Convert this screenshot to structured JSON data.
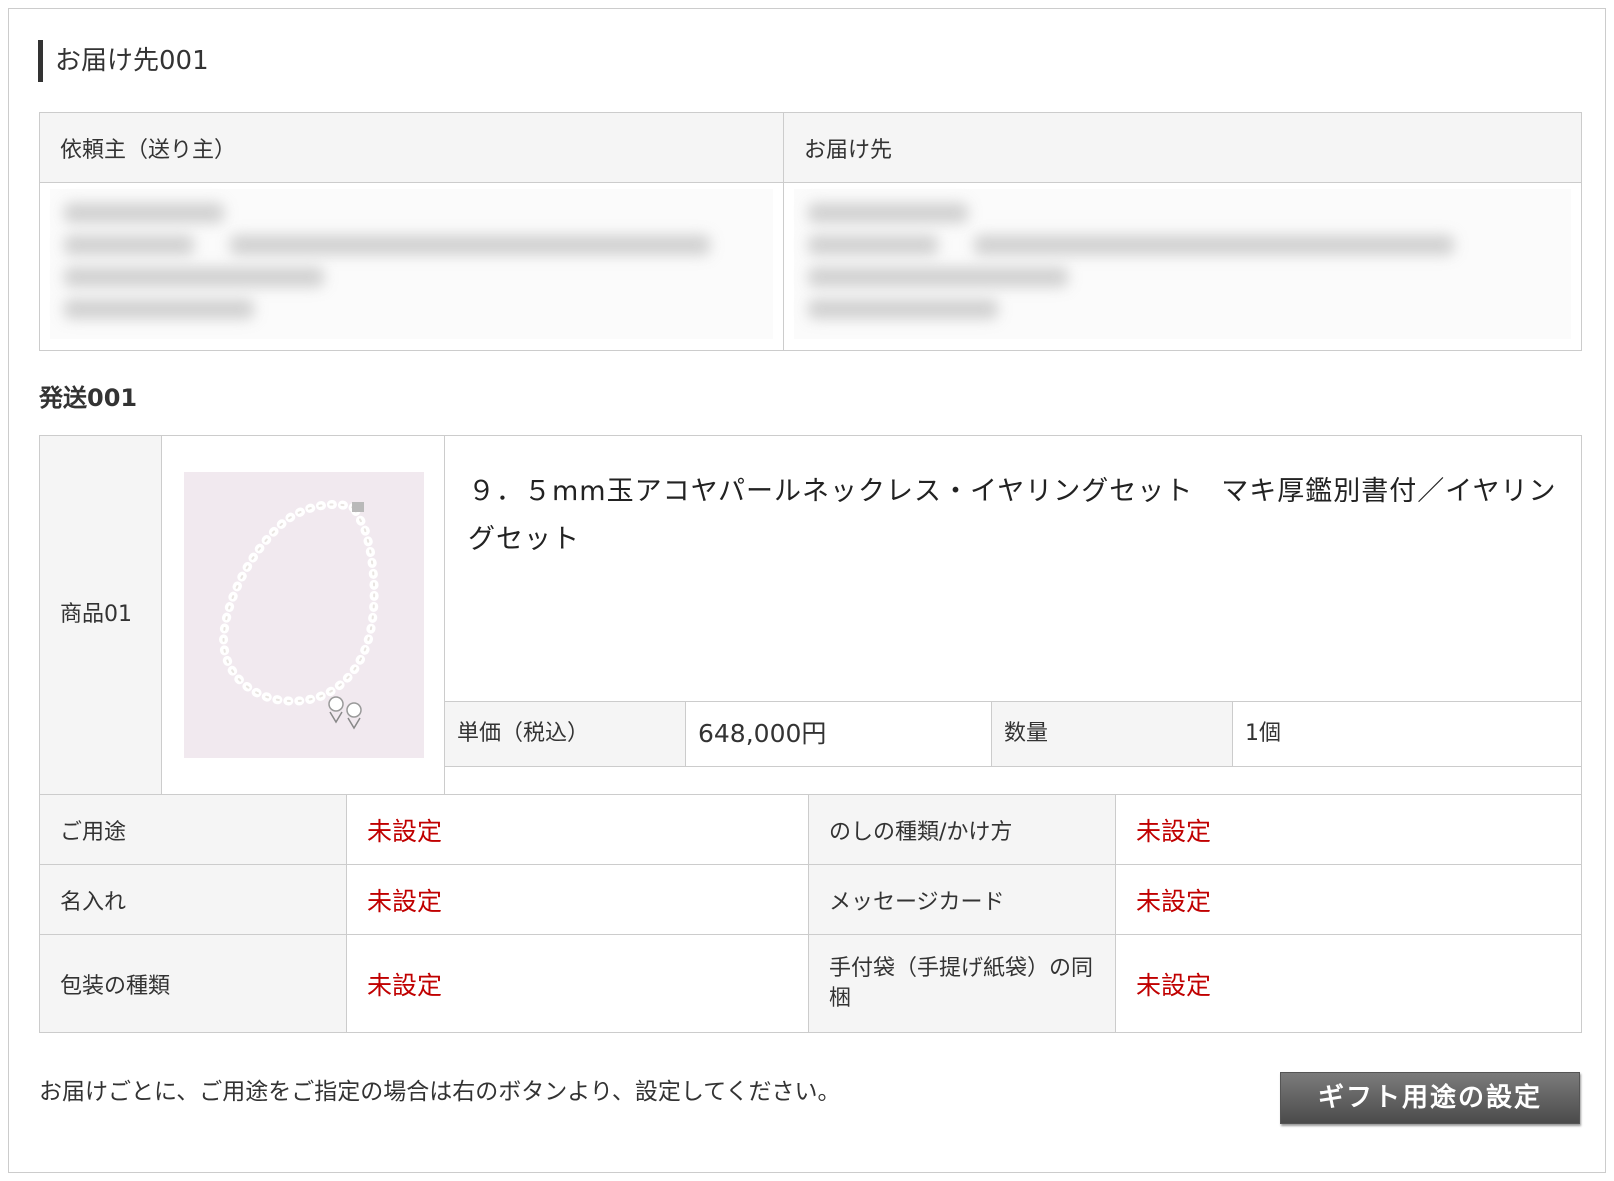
{
  "delivery": {
    "section_title": "お届け先001",
    "sender_header": "依頼主（送り主）",
    "recipient_header": "お届け先"
  },
  "shipment": {
    "title": "発送001",
    "product_label": "商品01",
    "product_name": "９．５mm玉アコヤパールネックレス・イヤリングセット　マキ厚鑑別書付／イヤリングセット",
    "unit_price_label": "単価（税込）",
    "unit_price": "648,000円",
    "quantity_label": "数量",
    "quantity": "1個"
  },
  "options": [
    {
      "label": "ご用途",
      "value": "未設定"
    },
    {
      "label": "のしの種類/かけ方",
      "value": "未設定"
    },
    {
      "label": "名入れ",
      "value": "未設定"
    },
    {
      "label": "メッセージカード",
      "value": "未設定"
    },
    {
      "label": "包装の種類",
      "value": "未設定"
    },
    {
      "label": "手付袋（手提げ紙袋）の同梱",
      "value": "未設定"
    }
  ],
  "footer": {
    "note": "お届けごとに、ご用途をご指定の場合は右のボタンより、設定してください。",
    "gift_button": "ギフト用途の設定"
  },
  "colors": {
    "unset_value": "#c00000",
    "header_bg": "#f5f5f5",
    "button_bg": "#5f5f5f"
  }
}
